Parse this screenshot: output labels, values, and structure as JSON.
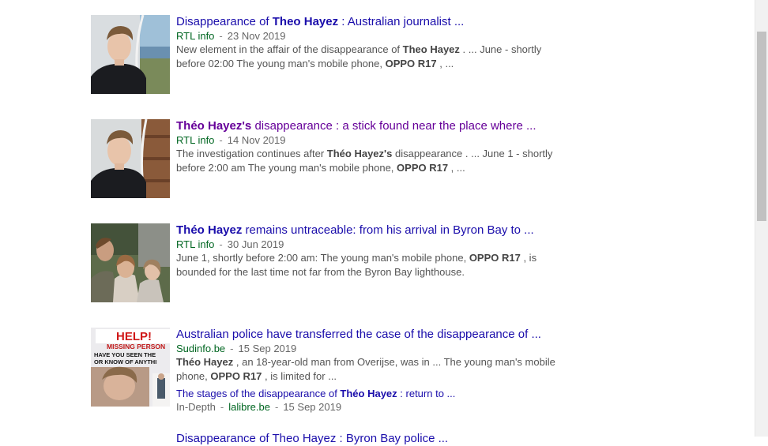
{
  "results": [
    {
      "title_parts": [
        {
          "t": "Disappearance of ",
          "b": false
        },
        {
          "t": "Theo Hayez",
          "b": true
        },
        {
          "t": " : Australian journalist ...",
          "b": false
        }
      ],
      "visited": false,
      "source": "RTL info",
      "date": "23 Nov 2019",
      "snippet_line1": [
        {
          "t": "New element in the affair of the disappearance of ",
          "b": false
        },
        {
          "t": "Theo Hayez",
          "b": true
        },
        {
          "t": " . ... June - shortly",
          "b": false
        }
      ],
      "snippet_line2": [
        {
          "t": "before 02:00 The young man's mobile phone, ",
          "b": false
        },
        {
          "t": "OPPO R17",
          "b": true
        },
        {
          "t": " , ...",
          "b": false
        }
      ]
    },
    {
      "title_parts": [
        {
          "t": "Théo Hayez's",
          "b": true
        },
        {
          "t": " disappearance : a stick found near the place where ...",
          "b": false
        }
      ],
      "visited": true,
      "source": "RTL info",
      "date": "14 Nov 2019",
      "snippet_line1": [
        {
          "t": "The investigation continues after ",
          "b": false
        },
        {
          "t": "Théo Hayez's",
          "b": true
        },
        {
          "t": " disappearance . ... June 1 - shortly",
          "b": false
        }
      ],
      "snippet_line2": [
        {
          "t": "before 2:00 am The young man's mobile phone, ",
          "b": false
        },
        {
          "t": "OPPO R17",
          "b": true
        },
        {
          "t": " , ...",
          "b": false
        }
      ]
    },
    {
      "title_parts": [
        {
          "t": "Théo Hayez",
          "b": true
        },
        {
          "t": " remains untraceable: from his arrival in Byron Bay to ...",
          "b": false
        }
      ],
      "visited": false,
      "source": "RTL info",
      "date": "30 Jun 2019",
      "snippet_line1": [
        {
          "t": "June 1, shortly before 2:00 am: The young man's mobile phone, ",
          "b": false
        },
        {
          "t": "OPPO R17",
          "b": true
        },
        {
          "t": " , is",
          "b": false
        }
      ],
      "snippet_line2": [
        {
          "t": "bounded for the last time not far from the Byron Bay lighthouse.",
          "b": false
        }
      ]
    },
    {
      "title_parts": [
        {
          "t": "Australian police have transferred the case of the disappearance of ...",
          "b": false
        }
      ],
      "visited": false,
      "source": "Sudinfo.be",
      "date": "15 Sep 2019",
      "snippet_line1": [
        {
          "t": "Théo Hayez",
          "b": true
        },
        {
          "t": " , an 18-year-old man from Overijse, was in ... The young man's mobile",
          "b": false
        }
      ],
      "snippet_line2": [
        {
          "t": "phone, ",
          "b": false
        },
        {
          "t": "OPPO R17",
          "b": true
        },
        {
          "t": " , is limited for ...",
          "b": false
        }
      ],
      "thumb_text": {
        "line1": "HELP!",
        "line2": "MISSING PERSON",
        "line3": "HAVE YOU SEEN THE",
        "line4": "OR KNOW OF ANYTHI"
      },
      "sub": {
        "title_parts": [
          {
            "t": "The stages of the disappearance of ",
            "b": false
          },
          {
            "t": "Théo Hayez",
            "b": true
          },
          {
            "t": " : return to ...",
            "b": false
          }
        ],
        "label": "In-Depth",
        "source": "lalibre.be",
        "date": "15 Sep 2019"
      }
    },
    {
      "title_parts": [
        {
          "t": "Disappearance of Theo Hayez : Byron Bay police ...",
          "b": false
        }
      ],
      "visited": false
    }
  ],
  "meta_separator": "-",
  "colors": {
    "link": "#1a0dab",
    "visited": "#660099",
    "source": "#006621",
    "snippet": "#545454"
  }
}
